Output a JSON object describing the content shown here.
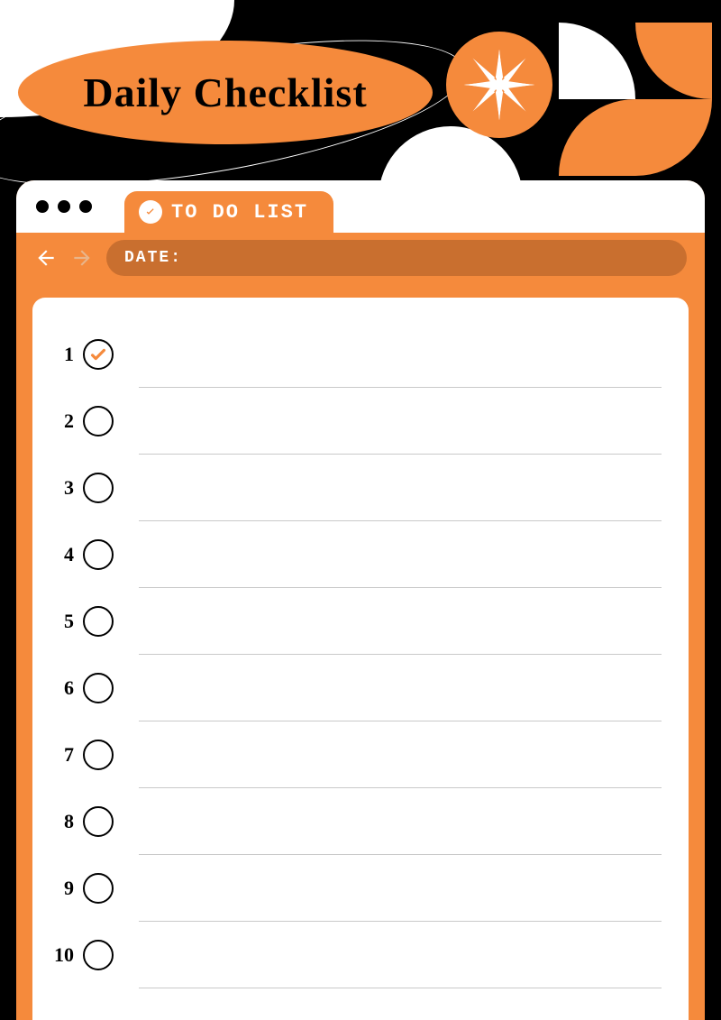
{
  "header": {
    "title": "Daily Checklist"
  },
  "tab": {
    "label": "TO DO LIST"
  },
  "toolbar": {
    "date_label": "DATE:"
  },
  "items": [
    {
      "num": "1",
      "checked": true,
      "text": ""
    },
    {
      "num": "2",
      "checked": false,
      "text": ""
    },
    {
      "num": "3",
      "checked": false,
      "text": ""
    },
    {
      "num": "4",
      "checked": false,
      "text": ""
    },
    {
      "num": "5",
      "checked": false,
      "text": ""
    },
    {
      "num": "6",
      "checked": false,
      "text": ""
    },
    {
      "num": "7",
      "checked": false,
      "text": ""
    },
    {
      "num": "8",
      "checked": false,
      "text": ""
    },
    {
      "num": "9",
      "checked": false,
      "text": ""
    },
    {
      "num": "10",
      "checked": false,
      "text": ""
    }
  ],
  "colors": {
    "accent": "#f58a3c",
    "accent_dark": "#c96f2f",
    "ink": "#000000"
  }
}
